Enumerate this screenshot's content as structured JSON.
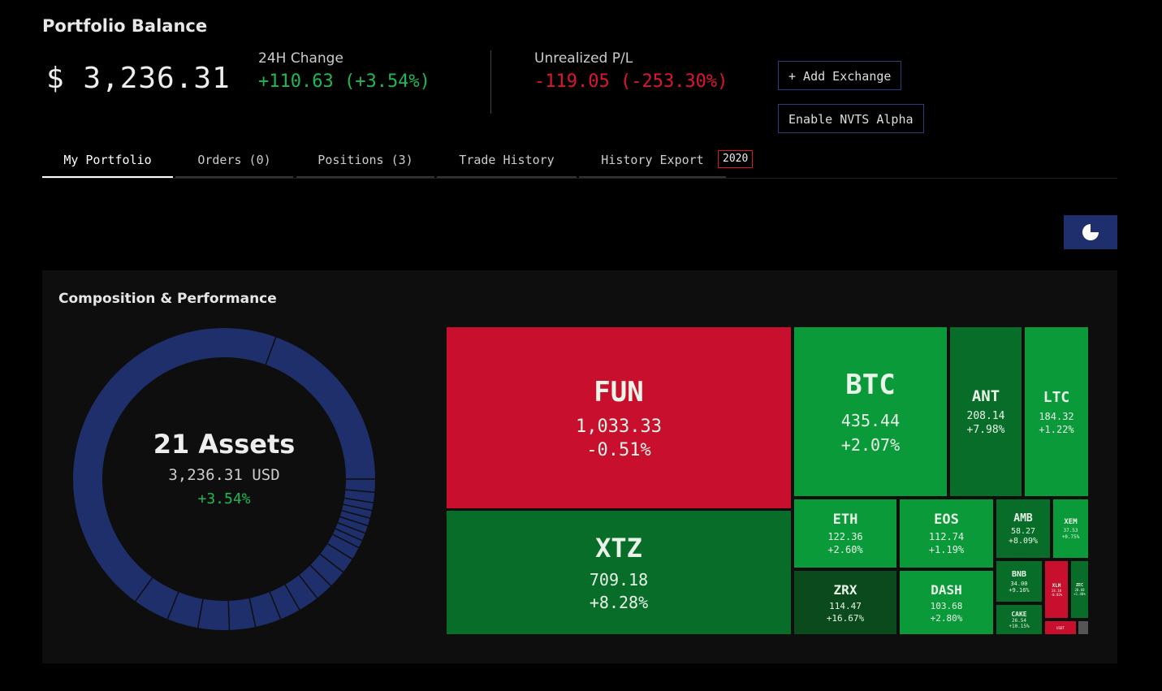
{
  "header": {
    "title": "Portfolio Balance",
    "balance": "$ 3,236.31",
    "change_label": "24H Change",
    "change_value": "+110.63 (+3.54%)",
    "pl_label": "Unrealized P/L",
    "pl_value": "-119.05 (-253.30%)",
    "add_exchange": "+ Add Exchange",
    "enable_alpha": "Enable NVTS Alpha"
  },
  "tabs": [
    {
      "label": "My Portfolio",
      "active": true
    },
    {
      "label": "Orders (0)"
    },
    {
      "label": "Positions (3)"
    },
    {
      "label": "Trade History"
    },
    {
      "label": "History Export"
    }
  ],
  "year_badge": "2020",
  "chart_toggle_icon": "pie-chart-icon",
  "panel": {
    "title": "Composition & Performance",
    "assets": "21 Assets",
    "total": "3,236.31 USD",
    "change": "+3.54%"
  },
  "colors": {
    "green": "#1db954",
    "red": "#e0142f",
    "donut": "#1e2f6b",
    "tile_red": "#c8102e",
    "tile_green": "#0a9a3a",
    "tile_dark_green": "#086d28"
  },
  "treemap": [
    {
      "symbol": "FUN",
      "value": "1,033.33",
      "change": "-0.51%"
    },
    {
      "symbol": "XTZ",
      "value": "709.18",
      "change": "+8.28%"
    },
    {
      "symbol": "BTC",
      "value": "435.44",
      "change": "+2.07%"
    },
    {
      "symbol": "ANT",
      "value": "208.14",
      "change": "+7.98%"
    },
    {
      "symbol": "LTC",
      "value": "184.32",
      "change": "+1.22%"
    },
    {
      "symbol": "ETH",
      "value": "122.36",
      "change": "+2.60%"
    },
    {
      "symbol": "EOS",
      "value": "112.74",
      "change": "+1.19%"
    },
    {
      "symbol": "AMB",
      "value": "58.27",
      "change": "+8.09%"
    },
    {
      "symbol": "XEM",
      "value": "37.53",
      "change": "+0.75%"
    },
    {
      "symbol": "ZRX",
      "value": "114.47",
      "change": "+16.67%"
    },
    {
      "symbol": "DASH",
      "value": "103.68",
      "change": "+2.80%"
    },
    {
      "symbol": "BNB",
      "value": "34.00",
      "change": "+9.16%"
    },
    {
      "symbol": "XLM",
      "value": "24.10",
      "change": "-0.02%"
    },
    {
      "symbol": "ZEC",
      "value": "20.60",
      "change": "+1.40%"
    },
    {
      "symbol": "CAKE",
      "value": "26.54",
      "change": "+10.15%"
    },
    {
      "symbol": "USDT",
      "value": "",
      "change": ""
    },
    {
      "symbol": "",
      "value": "",
      "change": ""
    }
  ]
}
